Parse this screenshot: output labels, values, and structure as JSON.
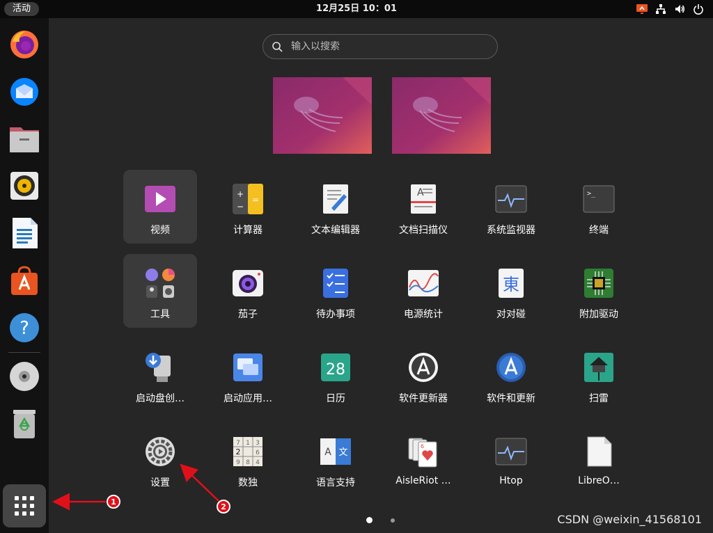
{
  "topbar": {
    "activities": "活动",
    "clock": "12月25日  10：01",
    "tray": [
      "screen-share-icon",
      "network-icon",
      "volume-icon",
      "power-icon"
    ]
  },
  "dock": {
    "items": [
      "firefox",
      "thunderbird",
      "files",
      "rhythmbox",
      "libreoffice-writer",
      "app-center",
      "help",
      "dvd",
      "trash"
    ],
    "show_apps": "show-apps-grid-icon"
  },
  "search": {
    "placeholder": "输入以搜索"
  },
  "apps": {
    "row1": [
      "视频",
      "计算器",
      "文本编辑器",
      "文档扫描仪",
      "系统监视器",
      "终端"
    ],
    "row2": [
      "工具",
      "茄子",
      "待办事项",
      "电源统计",
      "对对碰",
      "附加驱动"
    ],
    "row3": [
      "启动盘创…",
      "启动应用…",
      "日历",
      "软件更新器",
      "软件和更新",
      "扫雷"
    ],
    "row4": [
      "设置",
      "数独",
      "语言支持",
      "AisleRiot …",
      "Htop",
      "LibreO…"
    ]
  },
  "annotations": {
    "badge1": "1",
    "badge2": "2"
  },
  "watermark": "CSDN @weixin_41568101",
  "colors": {
    "accent": "#e95420",
    "annotation": "#e0101a"
  }
}
